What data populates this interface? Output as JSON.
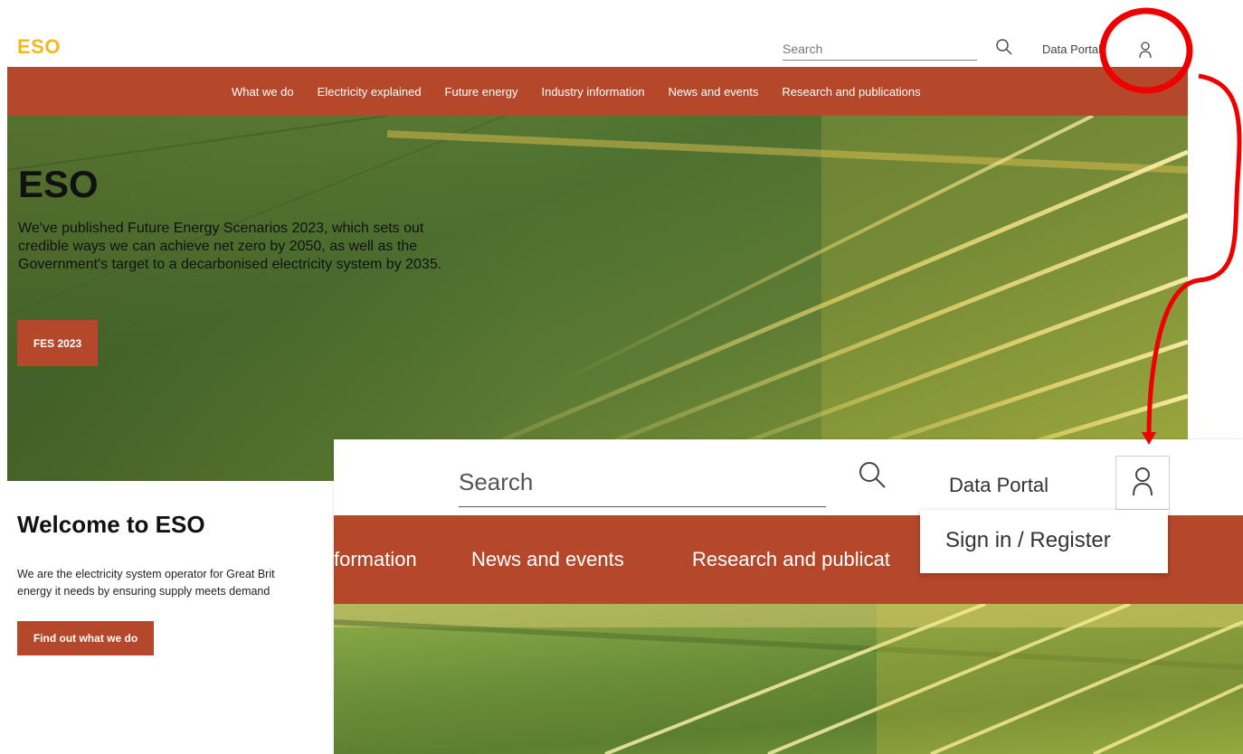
{
  "header": {
    "logo": "ESO",
    "search_placeholder": "Search",
    "data_portal": "Data Portal"
  },
  "nav": {
    "items": [
      "What we do",
      "Electricity explained",
      "Future energy",
      "Industry information",
      "News and events",
      "Research and publications"
    ]
  },
  "hero": {
    "title": "ESO",
    "text": "We've published Future Energy Scenarios 2023, which sets out credible ways we can achieve net zero by 2050, as well as the Government's target to a decarbonised electricity system by 2035.",
    "button": "FES 2023"
  },
  "welcome": {
    "title": "Welcome to ESO",
    "text_line1": "We are the electricity system operator for Great Brit",
    "text_line2": "energy it needs by ensuring supply meets demand",
    "button": "Find out what we do"
  },
  "zoom": {
    "search_placeholder": "Search",
    "data_portal": "Data Portal",
    "nav_items": [
      "formation",
      "News and events",
      "Research and publicat"
    ],
    "dropdown_item": "Sign in / Register"
  },
  "colors": {
    "brand_orange": "#b5482a",
    "logo_yellow": "#f2b91e",
    "annotation_red": "#ee0000"
  },
  "icons": {
    "search": "search-icon",
    "user": "user-icon"
  }
}
